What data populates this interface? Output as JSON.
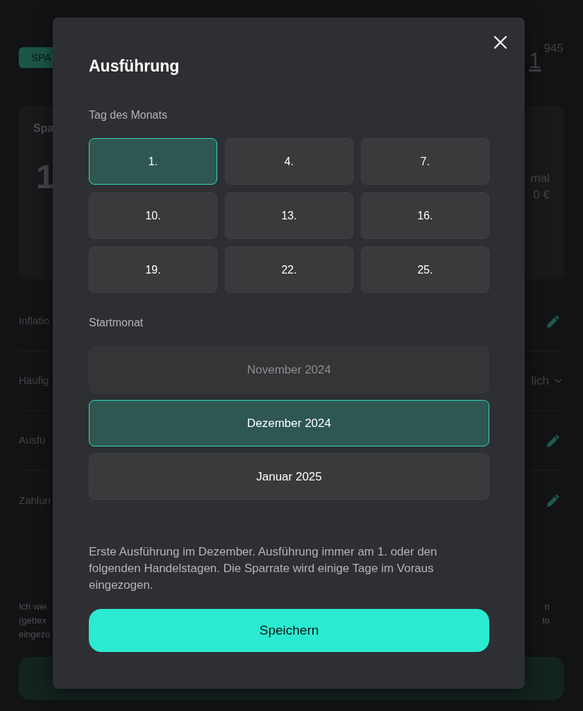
{
  "background": {
    "badge": "SPA",
    "price": {
      "whole": "1",
      "fraction": "945"
    },
    "card": {
      "title": "Spa",
      "amount": "1",
      "right_lines": [
        "mal",
        "0 €"
      ]
    },
    "rows": [
      {
        "kind": "edit",
        "label": "Inflatio"
      },
      {
        "kind": "select",
        "label": "Häufig",
        "value": "lich"
      },
      {
        "kind": "edit",
        "label": "Ausfü"
      },
      {
        "kind": "edit",
        "label": "Zahlun"
      }
    ],
    "note_left": [
      "Ich wei",
      "(gettex",
      "eingezo"
    ],
    "note_right": [
      "n",
      "to"
    ]
  },
  "dialog": {
    "title": "Ausführung",
    "day_label": "Tag des Monats",
    "days": [
      {
        "label": "1.",
        "selected": true
      },
      {
        "label": "4.",
        "selected": false
      },
      {
        "label": "7.",
        "selected": false
      },
      {
        "label": "10.",
        "selected": false
      },
      {
        "label": "13.",
        "selected": false
      },
      {
        "label": "16.",
        "selected": false
      },
      {
        "label": "19.",
        "selected": false
      },
      {
        "label": "22.",
        "selected": false
      },
      {
        "label": "25.",
        "selected": false
      }
    ],
    "month_label": "Startmonat",
    "months": [
      {
        "label": "November 2024",
        "selected": false,
        "disabled": true
      },
      {
        "label": "Dezember 2024",
        "selected": true,
        "disabled": false
      },
      {
        "label": "Januar 2025",
        "selected": false,
        "disabled": false
      }
    ],
    "note": "Erste Ausführung im Dezember. Ausführung immer am 1. oder den folgenden Handelstagen. Die Sparrate wird einige Tage im Voraus eingezogen.",
    "save_button": "Speichern"
  }
}
